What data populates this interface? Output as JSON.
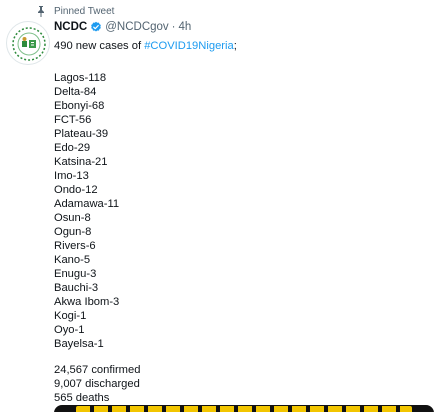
{
  "pinned_label": "Pinned Tweet",
  "author": {
    "name": "NCDC",
    "handle": "@NCDCgov",
    "separator": "·",
    "time": "4h"
  },
  "tweet": {
    "intro_text": "490 new cases of ",
    "hashtag": "#COVID19Nigeria",
    "intro_suffix": ";",
    "states": [
      "Lagos-118",
      "Delta-84",
      "Ebonyi-68",
      "FCT-56",
      "Plateau-39",
      "Edo-29",
      "Katsina-21",
      "Imo-13",
      "Ondo-12",
      "Adamawa-11",
      "Osun-8",
      "Ogun-8",
      "Rivers-6",
      "Kano-5",
      "Enugu-3",
      "Bauchi-3",
      "Akwa Ibom-3",
      "Kogi-1",
      "Oyo-1",
      "Bayelsa-1"
    ],
    "totals": [
      "24,567 confirmed",
      "9,007 discharged",
      "565 deaths"
    ]
  },
  "colors": {
    "link": "#1d9bf0",
    "secondary_text": "#536471",
    "verified_badge": "#1d9bf0"
  },
  "icons": {
    "pin": "pin-icon",
    "verified": "verified-badge-icon",
    "avatar": "ncdc-logo"
  }
}
